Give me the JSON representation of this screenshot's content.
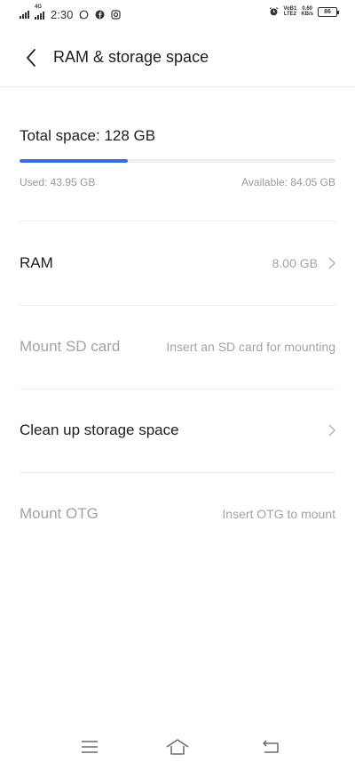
{
  "status_bar": {
    "network": "4G",
    "time": "2:30",
    "volte_top": "VoB1",
    "volte_bottom": "LTE2",
    "speed_value": "0.60",
    "speed_unit": "KB/s",
    "battery": "86"
  },
  "header": {
    "title": "RAM & storage space"
  },
  "storage": {
    "total_label": "Total space: 128 GB",
    "used_fraction": 0.3434,
    "used_label": "Used: 43.95 GB",
    "available_label": "Available: 84.05 GB",
    "accent": "#3f6ad8"
  },
  "rows": [
    {
      "label": "RAM",
      "value": "8.00 GB"
    },
    {
      "label": "Mount SD card",
      "value": "Insert an SD card for mounting"
    },
    {
      "label": "Clean up storage space",
      "value": ""
    },
    {
      "label": "Mount OTG",
      "value": "Insert OTG to mount"
    }
  ]
}
